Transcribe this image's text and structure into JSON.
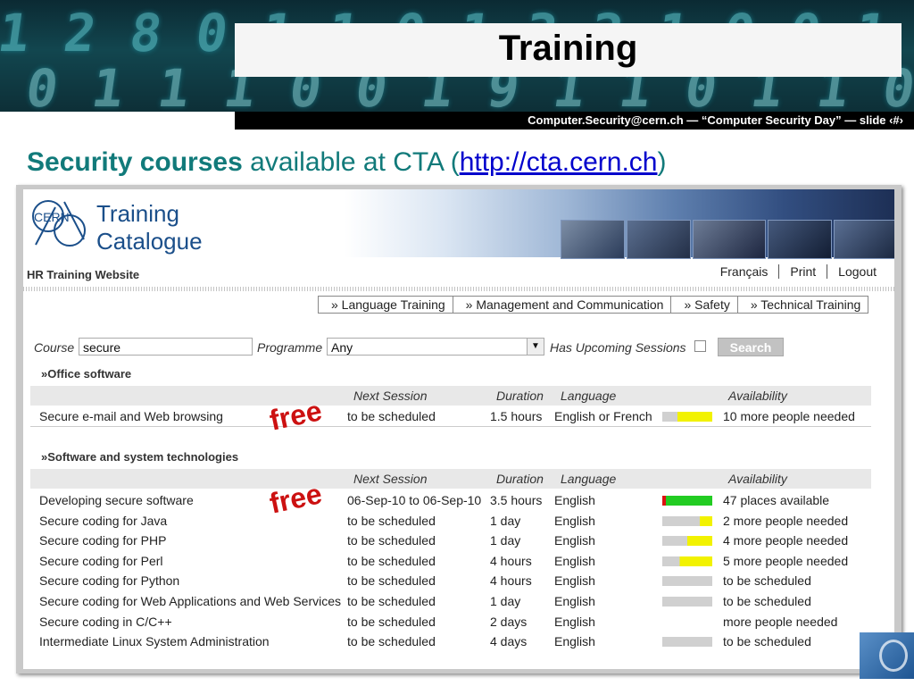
{
  "slide": {
    "title": "Training",
    "footer": "Computer.Security@cern.ch  —  “Computer Security Day” —  slide ‹#›",
    "heading_bold": "Security courses",
    "heading_rest": " available at CTA (",
    "heading_link": "http://cta.cern.ch",
    "heading_close": ")",
    "banner_digits": [
      "1 2 8 0 1 1 0 1 3 2 1 0 0 1",
      "0 1 1 1 0 0 1 9 1 1 0 1 1 0 1 1 1 0"
    ]
  },
  "catalogue": {
    "logo_text": "CERN",
    "title_line1": "Training",
    "title_line2": "Catalogue",
    "site_title": "HR Training Website",
    "top_links": [
      "Français",
      "Print",
      "Logout"
    ],
    "nav_tabs": [
      "» Language Training",
      "» Management and Communication",
      "» Safety",
      "» Technical Training"
    ],
    "search": {
      "course_label": "Course",
      "course_value": "secure",
      "programme_label": "Programme",
      "programme_value": "Any",
      "upcoming_label": "Has Upcoming Sessions",
      "search_button": "Search"
    },
    "columns": [
      "Next Session",
      "Duration",
      "Language",
      "Availability"
    ],
    "free_stamp": "free",
    "sections": [
      {
        "title": "»Office software",
        "rows": [
          {
            "course": "Secure e-mail and Web browsing",
            "session": "to be scheduled",
            "duration": "1.5 hours",
            "language": "English or French",
            "availability": "10 more people needed",
            "bar": "yellow",
            "fill": 0.7
          }
        ]
      },
      {
        "title": "»Software and system technologies",
        "rows": [
          {
            "course": "Developing secure software",
            "session": "06-Sep-10 to 06-Sep-10",
            "duration": "3.5 hours",
            "language": "English",
            "availability": "47 places available",
            "bar": "green",
            "fill": 1.0
          },
          {
            "course": "Secure coding for Java",
            "session": "to be scheduled",
            "duration": "1 day",
            "language": "English",
            "availability": "2 more people needed",
            "bar": "yellow",
            "fill": 0.25
          },
          {
            "course": "Secure coding for PHP",
            "session": "to be scheduled",
            "duration": "1 day",
            "language": "English",
            "availability": "4 more people needed",
            "bar": "yellow",
            "fill": 0.5
          },
          {
            "course": "Secure coding for Perl",
            "session": "to be scheduled",
            "duration": "4 hours",
            "language": "English",
            "availability": "5 more people needed",
            "bar": "yellow",
            "fill": 0.65
          },
          {
            "course": "Secure coding for Python",
            "session": "to be scheduled",
            "duration": "4 hours",
            "language": "English",
            "availability": "to be scheduled",
            "bar": "grey",
            "fill": 0
          },
          {
            "course": "Secure coding for Web Applications and Web Services",
            "session": "to be scheduled",
            "duration": "1 day",
            "language": "English",
            "availability": "to be scheduled",
            "bar": "grey",
            "fill": 0
          },
          {
            "course": "Secure coding in C/C++",
            "session": "to be scheduled",
            "duration": "2 days",
            "language": "English",
            "availability": "more people needed",
            "bar": "none",
            "fill": 0
          },
          {
            "course": "Intermediate Linux System Administration",
            "session": "to be scheduled",
            "duration": "4 days",
            "language": "English",
            "availability": "to be scheduled",
            "bar": "grey",
            "fill": 0
          }
        ]
      }
    ]
  },
  "colors": {
    "heading_teal": "#117a7a",
    "link_blue": "#0000cc",
    "free_red": "#cc1111",
    "bar_yellow": "#f2f200",
    "bar_green": "#22cc22",
    "bar_grey": "#d0d0d0",
    "bar_red": "#dd1111"
  }
}
